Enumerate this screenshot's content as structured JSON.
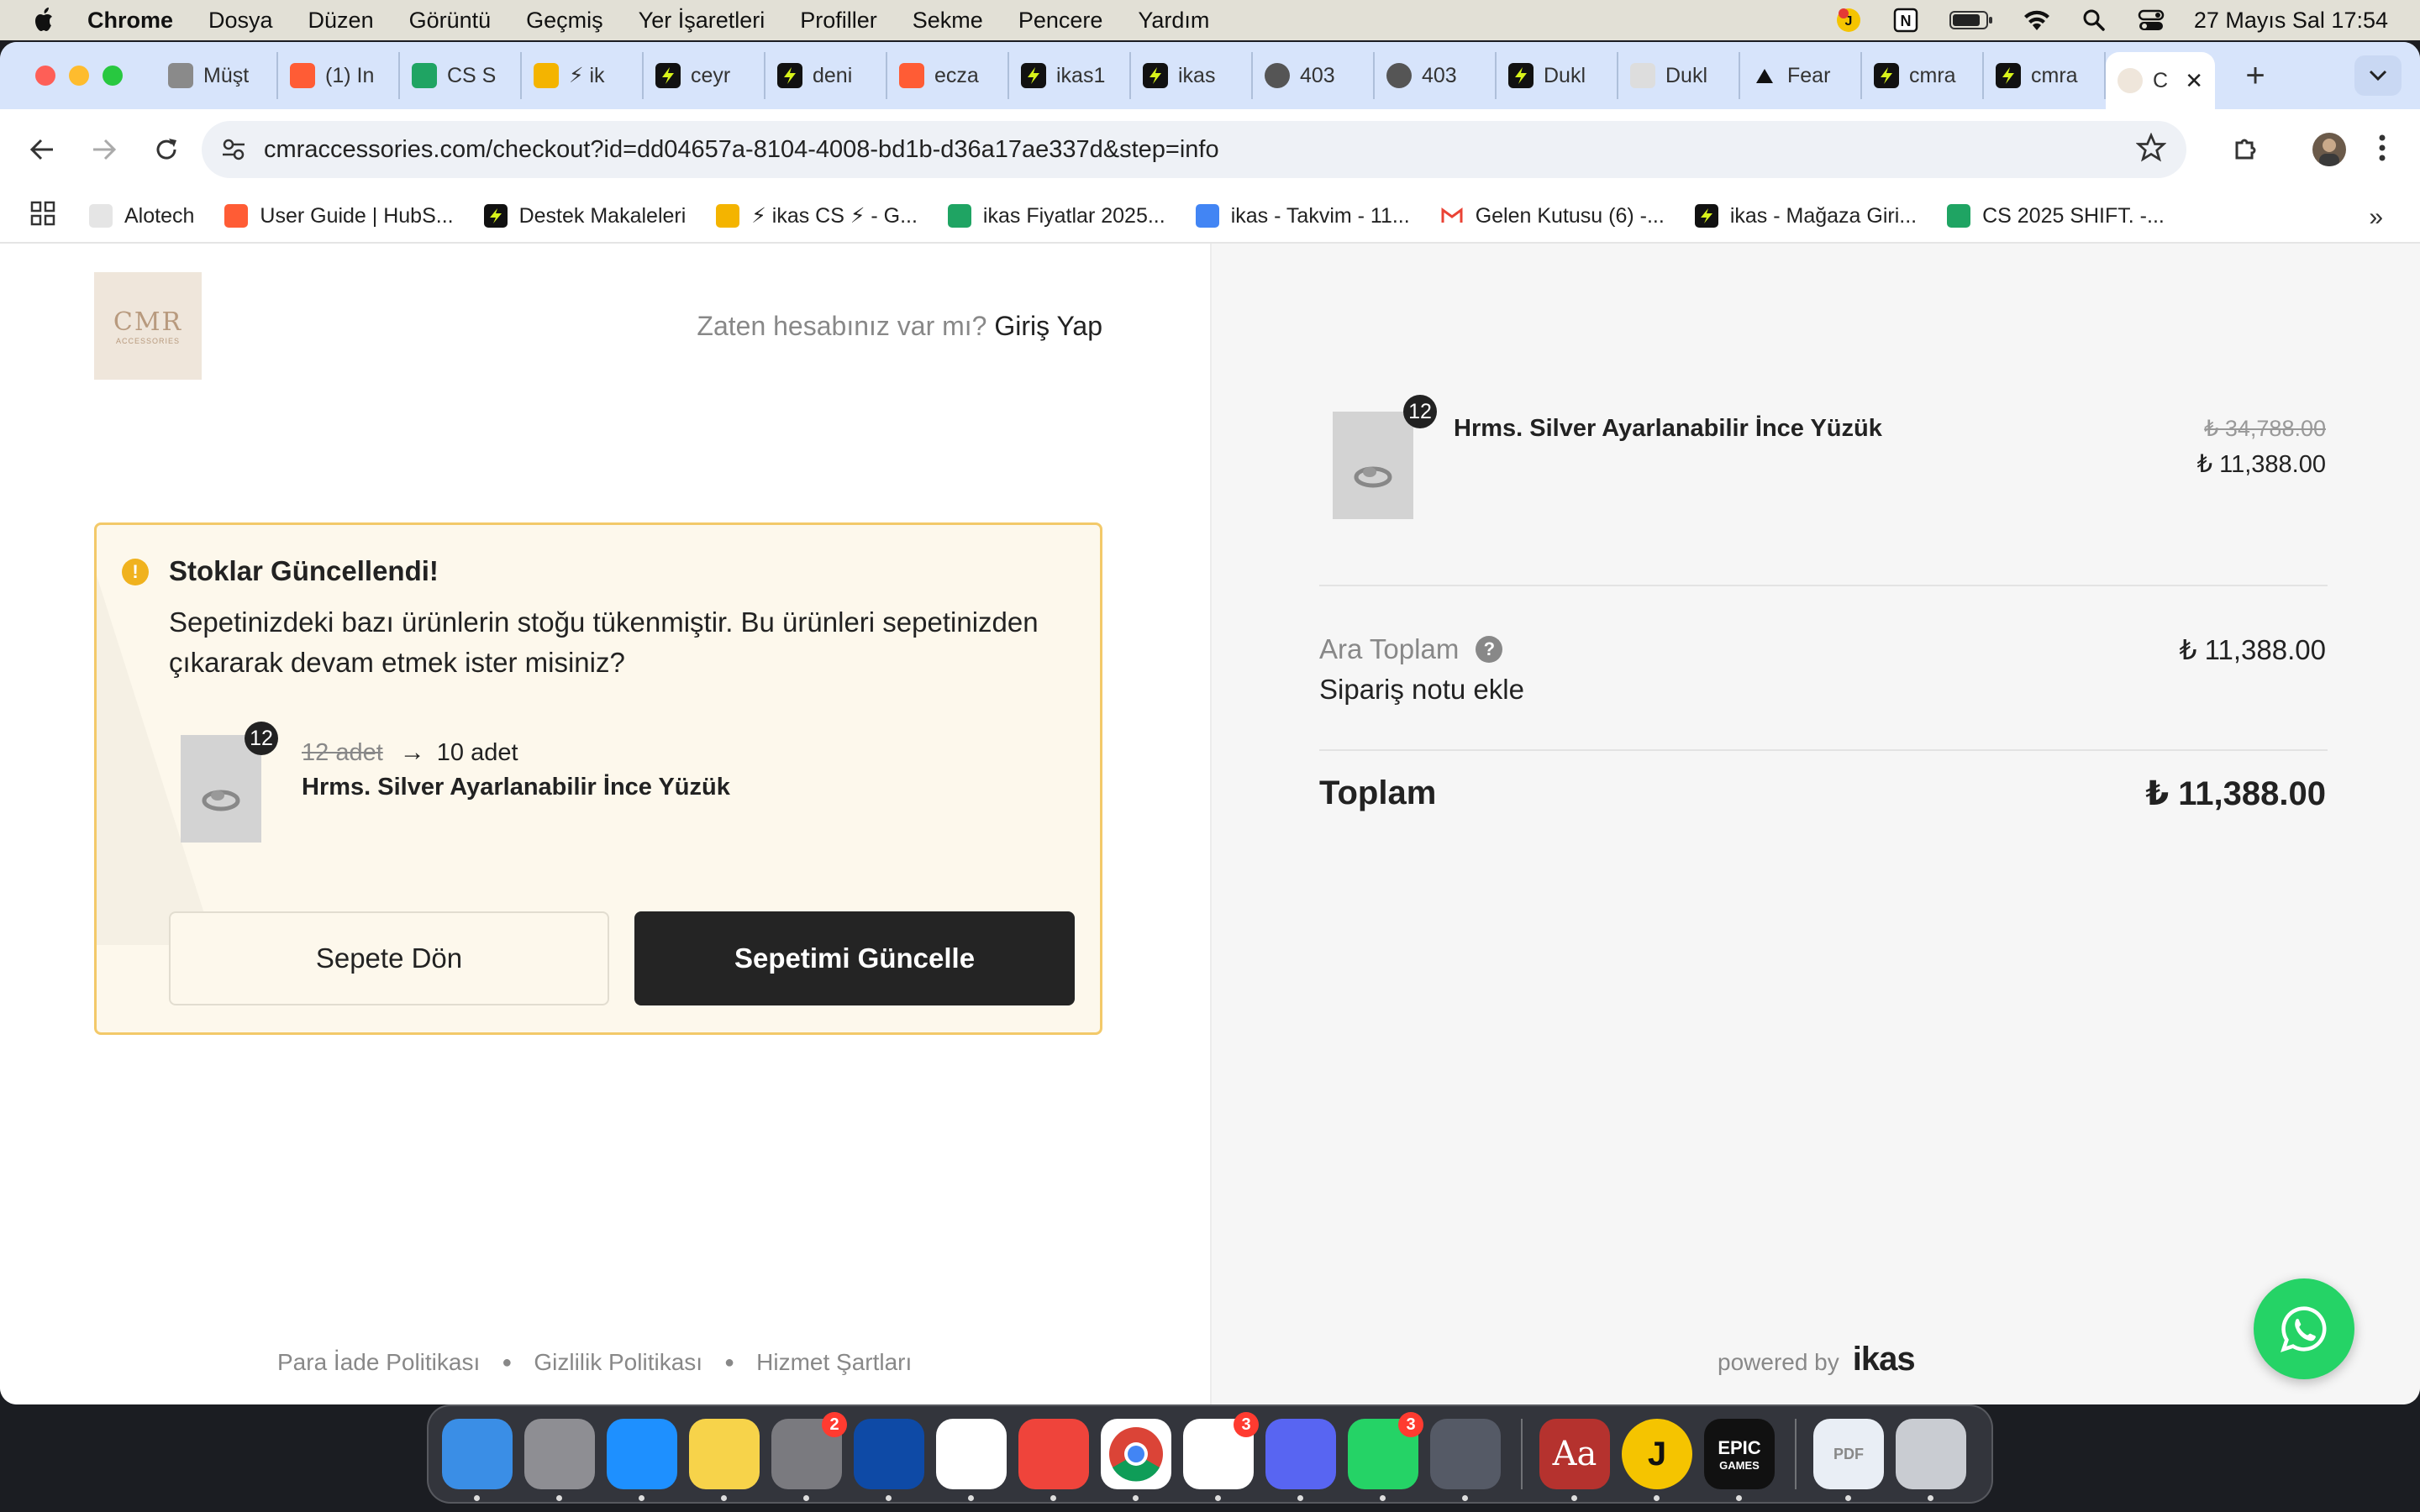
{
  "menubar": {
    "app": "Chrome",
    "items": [
      "Dosya",
      "Düzen",
      "Görüntü",
      "Geçmiş",
      "Yer İşaretleri",
      "Profiller",
      "Sekme",
      "Pencere",
      "Yardım"
    ],
    "datetime": "27 Mayıs Sal  17:54"
  },
  "tabs": [
    {
      "label": "Müşt",
      "icon": "cloud-icon",
      "color": "#8a8a8a"
    },
    {
      "label": "(1) In",
      "icon": "hubspot-icon",
      "color": "#ff5c35"
    },
    {
      "label": "CS S",
      "icon": "sheets-icon",
      "color": "#1fa463"
    },
    {
      "label": "⚡ ik",
      "icon": "slides-icon",
      "color": "#f4b400"
    },
    {
      "label": "ceyr",
      "icon": "ikas-icon",
      "color": "#111111"
    },
    {
      "label": "deni",
      "icon": "ikas-icon",
      "color": "#111111"
    },
    {
      "label": "ecza",
      "icon": "hubspot-icon",
      "color": "#ff5c35"
    },
    {
      "label": "ikas1",
      "icon": "ikas-icon",
      "color": "#111111"
    },
    {
      "label": "ikas",
      "icon": "ikas-icon",
      "color": "#111111"
    },
    {
      "label": "403",
      "icon": "globe-icon",
      "color": "#555555"
    },
    {
      "label": "403",
      "icon": "globe-icon",
      "color": "#555555"
    },
    {
      "label": "Dukl",
      "icon": "ikas-icon",
      "color": "#111111"
    },
    {
      "label": "Dukl",
      "icon": "ck-icon",
      "color": "#dddddd"
    },
    {
      "label": "Fear",
      "icon": "triangle-icon",
      "color": "#111111"
    },
    {
      "label": "cmra",
      "icon": "ikas-icon",
      "color": "#111111"
    },
    {
      "label": "cmra",
      "icon": "ikas-icon",
      "color": "#111111"
    }
  ],
  "active_tab": {
    "label": "C"
  },
  "address": {
    "url": "cmraccessories.com/checkout?id=dd04657a-8104-4008-bd1b-d36a17ae337d&step=info"
  },
  "bookmarks": [
    {
      "label": "Alotech",
      "icon": "cloud-icon",
      "color": "#8a8a8a"
    },
    {
      "label": "User Guide | HubS...",
      "icon": "hubspot-icon",
      "color": "#ff5c35"
    },
    {
      "label": "Destek Makaleleri",
      "icon": "ikas-icon",
      "color": "#111111"
    },
    {
      "label": "⚡ ikas CS ⚡ - G...",
      "icon": "slides-icon",
      "color": "#f4b400"
    },
    {
      "label": "ikas Fiyatlar 2025...",
      "icon": "sheets-icon",
      "color": "#1fa463"
    },
    {
      "label": "ikas - Takvim - 11...",
      "icon": "calendar-icon",
      "color": "#4285f4"
    },
    {
      "label": "Gelen Kutusu (6) -...",
      "icon": "gmail-icon",
      "color": "#ea4335"
    },
    {
      "label": "ikas - Mağaza Giri...",
      "icon": "ikas-icon",
      "color": "#111111"
    },
    {
      "label": "CS 2025 SHIFT. -...",
      "icon": "sheets-icon",
      "color": "#1fa463"
    }
  ],
  "checkout": {
    "logo_text": "CMR",
    "logo_sub": "ACCESSORIES",
    "login_prompt": "Zaten hesabınız var mı?",
    "login_link": "Giriş Yap",
    "alert": {
      "title": "Stoklar Güncellendi!",
      "message": "Sepetinizdeki bazı ürünlerin stoğu tükenmiştir. Bu ürünleri sepetinizden çıkararak devam etmek ister misiniz?",
      "badge": "12",
      "old_qty": "12 adet",
      "new_qty": "10 adet",
      "product": "Hrms. Silver Ayarlanabilir İnce Yüzük",
      "back_button": "Sepete Dön",
      "update_button": "Sepetimi Güncelle"
    },
    "footer_links": [
      "Para İade Politikası",
      "Gizlilik Politikası",
      "Hizmet Şartları"
    ]
  },
  "summary": {
    "item": {
      "badge": "12",
      "name": "Hrms. Silver Ayarlanabilir İnce Yüzük",
      "old_price": "₺ 34,788.00",
      "price": "₺ 11,388.00"
    },
    "subtotal_label": "Ara Toplam",
    "subtotal_help": "?",
    "subtotal": "₺ 11,388.00",
    "note_link": "Sipariş notu ekle",
    "total_label": "Toplam",
    "total": "₺ 11,388.00",
    "powered_by": "powered by",
    "brand": "ikas"
  },
  "dock": [
    {
      "name": "finder-icon",
      "color": "#3a8ee6",
      "badge": ""
    },
    {
      "name": "launchpad-icon",
      "color": "#8e8e93",
      "badge": ""
    },
    {
      "name": "safari-icon",
      "color": "#1e90ff",
      "badge": ""
    },
    {
      "name": "notes-icon",
      "color": "#f7d34a",
      "badge": ""
    },
    {
      "name": "system-settings-icon",
      "color": "#7a7a7f",
      "badge": "2"
    },
    {
      "name": "teamviewer-icon",
      "color": "#0e4aa6",
      "badge": ""
    },
    {
      "name": "notion-icon",
      "color": "#ffffff",
      "badge": ""
    },
    {
      "name": "anydesk-icon",
      "color": "#ef443b",
      "badge": ""
    },
    {
      "name": "chrome-icon",
      "color": "#ffffff",
      "badge": ""
    },
    {
      "name": "slack-icon",
      "color": "#ffffff",
      "badge": "3"
    },
    {
      "name": "discord-icon",
      "color": "#5865f2",
      "badge": ""
    },
    {
      "name": "whatsapp-icon",
      "color": "#25d366",
      "badge": "3"
    },
    {
      "name": "quicktime-icon",
      "color": "#555a66",
      "badge": ""
    },
    {
      "name": "dictionary-icon",
      "color": "#b5322e",
      "badge": ""
    },
    {
      "name": "joplin-icon",
      "color": "#f5c400",
      "badge": ""
    },
    {
      "name": "epic-games-icon",
      "color": "#111111",
      "badge": ""
    },
    {
      "name": "pdf-icon",
      "color": "#e9eef5",
      "badge": ""
    },
    {
      "name": "trash-icon",
      "color": "#c9ccd2",
      "badge": ""
    }
  ],
  "dock_text": {
    "dictionary": "Aa",
    "joplin": "J",
    "epic": "EPIC",
    "epic_sub": "GAMES",
    "pdf": "PDF"
  }
}
